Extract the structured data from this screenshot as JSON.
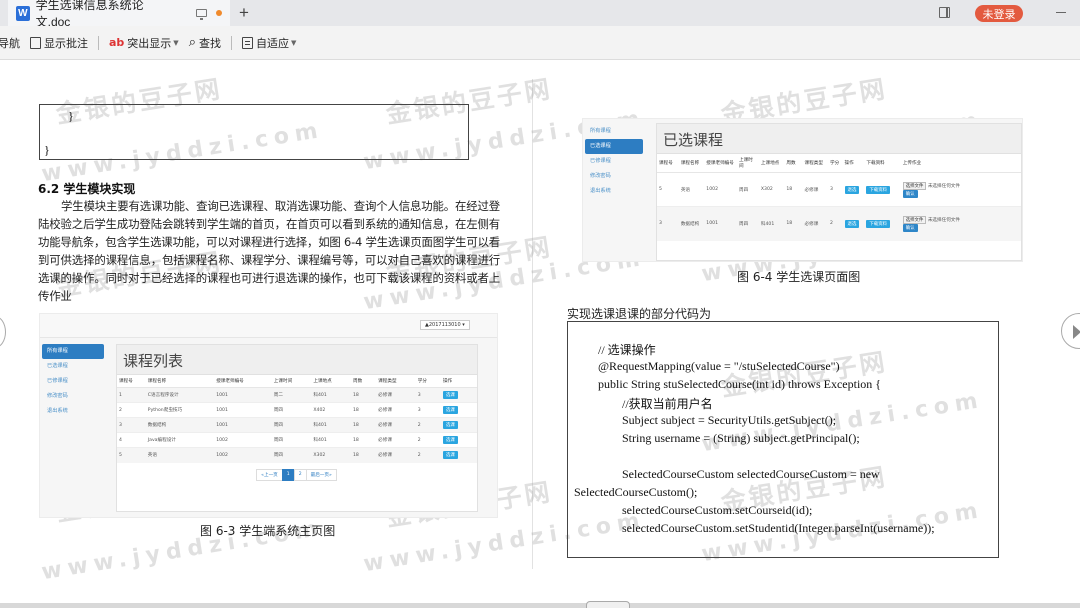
{
  "titlebar": {
    "doc_icon_letter": "W",
    "tab_title": "学生选课信息系统论文.doc",
    "new_tab_symbol": "+",
    "login_label": "未登录"
  },
  "toolbar": {
    "items": [
      {
        "label": "导航",
        "icon": "navigation-icon"
      },
      {
        "label": "显示批注",
        "icon": "comment-icon"
      },
      {
        "label": "突出显示",
        "icon": "highlight-icon"
      },
      {
        "label": "查找",
        "icon": "search-icon"
      },
      {
        "label": "自适应",
        "icon": "fit-icon"
      }
    ]
  },
  "left_page": {
    "code_top": {
      "line1": "}",
      "line2": "}"
    },
    "section_heading": "6.2 学生模块实现",
    "paragraph": "学生模块主要有选课功能、查询已选课程、取消选课功能、查询个人信息功能。在经过登陆校验之后学生成功登陆会跳转到学生端的首页，在首页可以看到系统的通知信息，在左侧有功能导航条，包含学生选课功能，可以对课程进行选择，如图 6-4 学生选课页面图学生可以看到可供选择的课程信息，包括课程名称、课程学分、课程编号等，可以对自己喜欢的课程进行选课的操作。同时对于已经选择的课程也可进行退选课的操作，也可下载该课程的资料或者上传作业",
    "screenshot": {
      "user_dropdown": "▲2017113010 ▾",
      "sidebar": [
        "所有课程",
        "已选课程",
        "已修课程",
        "修改密码",
        "退出系统"
      ],
      "panel_title": "课程列表",
      "columns": [
        "课程号",
        "课程名称",
        "授课老师编号",
        "上课时间",
        "上课地点",
        "周数",
        "课程类型",
        "学分",
        "操作"
      ],
      "rows": [
        [
          "1",
          "C语言程序设计",
          "1001",
          "周二",
          "科401",
          "18",
          "必修课",
          "3",
          "选课"
        ],
        [
          "2",
          "Python爬虫技巧",
          "1001",
          "周四",
          "X402",
          "18",
          "必修课",
          "3",
          "选课"
        ],
        [
          "3",
          "数据结构",
          "1001",
          "周四",
          "科401",
          "18",
          "必修课",
          "2",
          "选课"
        ],
        [
          "4",
          "Java编程设计",
          "1002",
          "周四",
          "科401",
          "18",
          "必修课",
          "2",
          "选课"
        ],
        [
          "5",
          "英语",
          "1002",
          "周四",
          "X302",
          "18",
          "必修课",
          "2",
          "选课"
        ]
      ],
      "pager": [
        "«上一页",
        "1",
        "2",
        "最后一页»"
      ]
    },
    "caption": "图 6-3 学生端系统主页图"
  },
  "right_page": {
    "screenshot": {
      "sidebar": [
        "所有课程",
        "已选课程",
        "已修课程",
        "修改密码",
        "退出系统"
      ],
      "panel_title": "已选课程",
      "columns": [
        "课程号",
        "课程名称",
        "授课老师编号",
        "上课时间",
        "上课地点",
        "周数",
        "课程类型",
        "学分",
        "操作",
        "下载资料",
        "上传作业"
      ],
      "rows": [
        {
          "cells": [
            "5",
            "英语",
            "1002",
            "周四",
            "X302",
            "18",
            "必修课",
            "3"
          ],
          "action": "退选",
          "download": "下载资料",
          "file_button": "选择文件",
          "file_status": "未选择任何文件",
          "confirm": "确认"
        },
        {
          "cells": [
            "3",
            "数据结构",
            "1001",
            "周四",
            "科401",
            "18",
            "必修课",
            "2"
          ],
          "action": "退选",
          "download": "下载资料",
          "file_button": "选择文件",
          "file_status": "未选择任何文件",
          "confirm": "确认"
        }
      ]
    },
    "caption": "图 6-4 学生选课页面图",
    "code_intro": "实现选课退课的部分代码为",
    "code_lines": [
      "//  选课操作",
      "@RequestMapping(value = \"/stuSelectedCourse\")",
      "public String stuSelectedCourse(int id) throws Exception {",
      "//获取当前用户名",
      "Subject subject = SecurityUtils.getSubject();",
      "String username = (String) subject.getPrincipal();",
      "SelectedCourseCustom selectedCourseCustom = new",
      "SelectedCourseCustom();",
      "selectedCourseCustom.setCourseid(id);",
      "selectedCourseCustom.setStudentid(Integer.parseInt(username));"
    ]
  },
  "watermark": {
    "cn": "金银的豆子网",
    "en": "www.jyddzi.com"
  }
}
